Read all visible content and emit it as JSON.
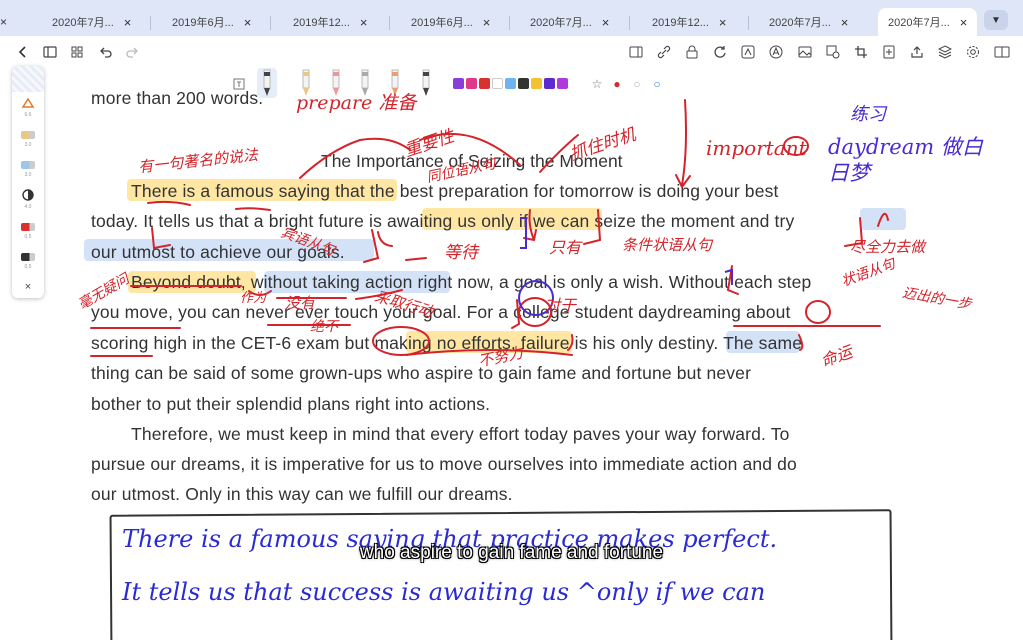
{
  "tabs": [
    {
      "label": "2020年7月...",
      "close": "×"
    },
    {
      "label": "2019年6月...",
      "close": "×"
    },
    {
      "label": "2019年12...",
      "close": "×"
    },
    {
      "label": "2019年6月...",
      "close": "×"
    },
    {
      "label": "2020年7月...",
      "close": "×"
    },
    {
      "label": "2019年12...",
      "close": "×"
    },
    {
      "label": "2020年7月...",
      "close": "×"
    },
    {
      "label": "2020年7月...",
      "close": "×",
      "active": true
    }
  ],
  "tab_menu_icon": "▼",
  "leading_close": "×",
  "toolbar": {
    "left_icons": [
      "back-icon",
      "sidebar-icon",
      "grid-icon",
      "undo-icon",
      "redo-icon"
    ],
    "right_icons": [
      "reader-icon",
      "link-icon",
      "lock-icon",
      "refresh-icon",
      "ocr-icon",
      "text-icon",
      "image-icon",
      "shape-icon",
      "crop-icon",
      "export-icon",
      "share-icon",
      "layers-icon",
      "settings-icon",
      "split-view-icon"
    ]
  },
  "pens": [
    "#444444",
    "#e8c88a",
    "#e89a9a",
    "#aaaaaa",
    "#e8a070",
    "#444444"
  ],
  "palette": [
    "#8a3dd9",
    "#e0388a",
    "#d93030",
    "#ffffff",
    "#6fb3f0",
    "#333333",
    "#f2c233",
    "#5b2bd1",
    "#b03ad9"
  ],
  "pen_extras": [
    "☆",
    "●",
    "○",
    "○"
  ],
  "left_panel": [
    {
      "icon": "eraser-icon",
      "val": "6.6"
    },
    {
      "icon": "pen-icon",
      "val": "3.0"
    },
    {
      "icon": "pen-icon",
      "val": "3.0"
    },
    {
      "icon": "toggle-icon",
      "val": "4.0"
    },
    {
      "icon": "pen-icon",
      "val": "0.5"
    },
    {
      "icon": "pen-icon",
      "val": "0.5"
    }
  ],
  "left_panel_close": "×",
  "document": {
    "top_line": "more than 200 words.",
    "title": "The Importance of Seizing the Moment",
    "lines": [
      "There is a famous saying that the best preparation for tomorrow is doing your best",
      "today. It tells us that a bright future is awaiting us only if we can seize the moment and try",
      "our utmost to achieve our goals.",
      "Beyond doubt, without taking action right now, a goal is only a wish. Without each step",
      "you move, you can never ever touch your goal. For a college student daydreaming about",
      "scoring high in the CET-6 exam but making no efforts, failure is his only destiny. The same",
      "thing can be said of some grown-ups who aspire to gain fame and fortune but never",
      "bother to put their splendid plans right into actions.",
      "Therefore, we must keep in mind that every effort today paves your way forward. To",
      "pursue our dreams, it is imperative for us to move ourselves into immediate action and do",
      "our utmost. Only in this way can we fulfill our dreams."
    ]
  },
  "annotations": {
    "red": [
      "prepare 准备",
      "重要性",
      "抓住时机",
      "有一句著名的说法",
      "同位语从句",
      "important",
      "宾语从句",
      "等待",
      "只有",
      "条件状语从句",
      "尽全力去做",
      "毫无疑问",
      "采取行动",
      "状语从句",
      "迈出的一步",
      "没有",
      "绝不",
      "对于",
      "作为",
      "命运",
      "不努力"
    ],
    "purple": [
      "练习",
      "daydream 做白日梦"
    ]
  },
  "handwriting": [
    "There is a famous saying that practice makes perfect.",
    "It tells us that success is awaiting us ^only if we can"
  ],
  "subtitle": "who aspire to gain fame and fortune"
}
